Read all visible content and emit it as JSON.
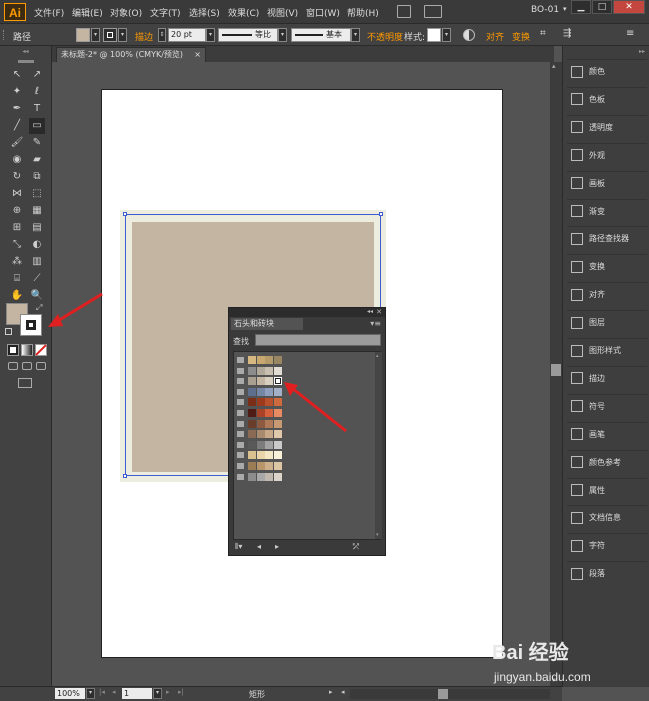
{
  "app": {
    "logo": "Ai",
    "workspace": "BO-01"
  },
  "menu": [
    "文件(F)",
    "编辑(E)",
    "对象(O)",
    "文字(T)",
    "选择(S)",
    "效果(C)",
    "视图(V)",
    "窗口(W)",
    "帮助(H)"
  ],
  "window_controls": {
    "minimize": "▁",
    "maximize": "□",
    "close": "✕"
  },
  "control_bar": {
    "object_type": "路径",
    "stroke_label": "描边",
    "stroke_weight": "20 pt",
    "profile_label": "等比",
    "brush_label": "基本",
    "opacity_label": "不透明度",
    "style_label": "样式:",
    "align_label": "对齐",
    "transform_label": "变换",
    "fill_color": "#c4b5a3",
    "stroke_color": "#ffffff"
  },
  "document_tab": {
    "title": "未标题-2* @ 100% (CMYK/预览)",
    "close": "×"
  },
  "right_panels": [
    {
      "label": "颜色",
      "icon": "color-icon"
    },
    {
      "label": "色板",
      "icon": "swatches-icon"
    },
    {
      "label": "透明度",
      "icon": "transparency-icon"
    },
    {
      "label": "外观",
      "icon": "appearance-icon"
    },
    {
      "label": "画板",
      "icon": "artboards-icon"
    },
    {
      "label": "渐变",
      "icon": "gradient-icon"
    },
    {
      "label": "路径查找器",
      "icon": "pathfinder-icon"
    },
    {
      "label": "变换",
      "icon": "transform-icon"
    },
    {
      "label": "对齐",
      "icon": "align-icon"
    },
    {
      "label": "图层",
      "icon": "layers-icon"
    },
    {
      "label": "图形样式",
      "icon": "graphic-styles-icon"
    },
    {
      "label": "描边",
      "icon": "stroke-icon"
    },
    {
      "label": "符号",
      "icon": "symbols-icon"
    },
    {
      "label": "画笔",
      "icon": "brushes-icon"
    },
    {
      "label": "颜色参考",
      "icon": "color-guide-icon"
    },
    {
      "label": "属性",
      "icon": "attributes-icon"
    },
    {
      "label": "文档信息",
      "icon": "document-info-icon"
    },
    {
      "label": "字符",
      "icon": "character-icon"
    },
    {
      "label": "段落",
      "icon": "paragraph-icon"
    }
  ],
  "floating_panel": {
    "tab_label": "石头和砖块",
    "search_label": "查找",
    "search_value": "",
    "rows": [
      [
        "#d6b880",
        "#c9a870",
        "#b59a6a",
        "#9b8664"
      ],
      [
        "#8c8c8c",
        "#b0a898",
        "#c9bfb0",
        "#e2ddd4"
      ],
      [
        "#a89f91",
        "#c4b5a3",
        "#d8cfc1",
        "#ffffff"
      ],
      [
        "#5e6f8e",
        "#7486a4",
        "#8e9ebb",
        "#a3b0c8"
      ],
      [
        "#7a2e18",
        "#9c3a1e",
        "#b7502b",
        "#cf6a3e"
      ],
      [
        "#4e1c14",
        "#a8432a",
        "#d5603c",
        "#e88a62"
      ],
      [
        "#6a3c2a",
        "#8b5a40",
        "#b07a58",
        "#c89a74"
      ],
      [
        "#8a6a52",
        "#a88a6e",
        "#c7a888",
        "#e0c8aa"
      ],
      [
        "#595959",
        "#7c7c7c",
        "#a2a2a2",
        "#c9c9c9"
      ],
      [
        "#d9c08e",
        "#e8d4a8",
        "#f2e6c4",
        "#f8f0d8"
      ],
      [
        "#9c7c54",
        "#b8956a",
        "#cdb08a",
        "#dcc6a4"
      ],
      [
        "#8c8c8c",
        "#a8a8a8",
        "#c0b8ac",
        "#dcd4c8"
      ]
    ]
  },
  "status_bar": {
    "zoom": "100%",
    "artboard_number": "1",
    "tool_name": "矩形"
  },
  "watermark": {
    "line1": "Bai 经验",
    "line2": "jingyan.baidu.com"
  }
}
